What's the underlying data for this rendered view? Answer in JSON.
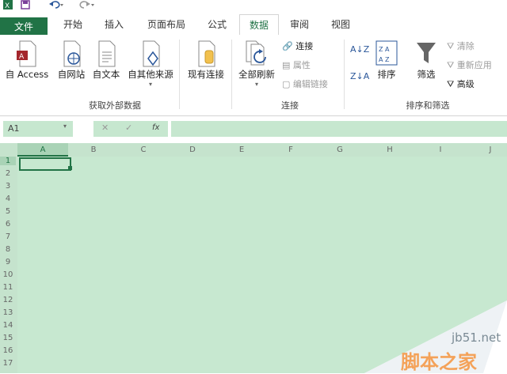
{
  "quick_access": {
    "app_icon": "excel-logo-icon",
    "save_icon": "save-icon",
    "undo_icon": "undo-icon",
    "redo_icon": "redo-icon"
  },
  "tabs": [
    {
      "label": "文件"
    },
    {
      "label": "开始"
    },
    {
      "label": "插入"
    },
    {
      "label": "页面布局"
    },
    {
      "label": "公式"
    },
    {
      "label": "数据"
    },
    {
      "label": "审阅"
    },
    {
      "label": "视图"
    }
  ],
  "active_tab": "数据",
  "ribbon": {
    "external": {
      "access": "自 Access",
      "web": "自网站",
      "text": "自文本",
      "other": "自其他来源",
      "existing": "现有连接",
      "group_label": "获取外部数据"
    },
    "connections": {
      "refresh_all": "全部刷新",
      "connections": "连接",
      "properties": "属性",
      "edit_links": "编辑链接",
      "group_label": "连接"
    },
    "sort_filter": {
      "sort_az": "A↓Z",
      "sort_za": "Z↓A",
      "sort": "排序",
      "filter": "筛选",
      "clear": "清除",
      "reapply": "重新应用",
      "advanced": "高级",
      "group_label": "排序和筛选"
    }
  },
  "formula_bar": {
    "name_box": "A1",
    "fx": "fx",
    "cancel": "✕",
    "enter": "✓"
  },
  "columns": [
    "A",
    "B",
    "C",
    "D",
    "E",
    "F",
    "G",
    "H",
    "I",
    "J"
  ],
  "rows": [
    "1",
    "2",
    "3",
    "4",
    "5",
    "6",
    "7",
    "8",
    "9",
    "10",
    "11",
    "12",
    "13",
    "14",
    "15",
    "16",
    "17"
  ],
  "watermark": {
    "site": "jb51.net",
    "name": "脚本之家"
  },
  "colors": {
    "accent": "#217346",
    "grid": "#c7e8d0"
  }
}
